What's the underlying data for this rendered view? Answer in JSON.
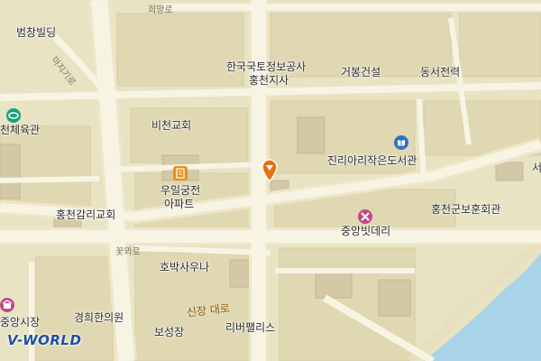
{
  "colors": {
    "land": "#e8e3c3",
    "block": "#dfd8b2",
    "road": "#f7f4e4",
    "major_road": "#ede6c8",
    "water": "#a9d3e6",
    "building": "#d3c9a6",
    "poi_green": "#1aa37a",
    "poi_pink": "#c2478a",
    "poi_blue": "#2d73c9",
    "poi_orange": "#e8901a",
    "marker": "#e2720f",
    "logo": "#1f4fa0"
  },
  "roads": {
    "road_top": "희망로",
    "road_diag": "마지기로",
    "road_mid": "꽃뫼로",
    "road_main": "신장 대로"
  },
  "places": {
    "beomchang": "범창빌딩",
    "lx_1": "한국국토정보공사",
    "lx_2": "홍천지사",
    "geobong": "거봉건설",
    "dongseo": "동서전력",
    "gymnasium": "천체육관",
    "bicheon_church": "비천교회",
    "jinri_library": "진리아리작은도서관",
    "uil_apt_1": "우일궁전",
    "uil_apt_2": "아파트",
    "hongcheon_church": "홍천감리교회",
    "jungang_bakery": "중앙빗데리",
    "veterans": "홍천군보훈회관",
    "hobak_sauna": "호박사우나",
    "market": "중앙시장",
    "gyeonghui_clinic": "경희한의원",
    "riverpalace": "리버팰리스",
    "boseong": "보성장",
    "edge_char": "서"
  },
  "icons": {
    "gymnasium": "stadium-icon",
    "library": "book-icon",
    "apartment": "building-icon",
    "bakery": "tools-icon",
    "market": "market-icon",
    "marker": "location-pin-icon"
  },
  "logo": "V-WORLD"
}
